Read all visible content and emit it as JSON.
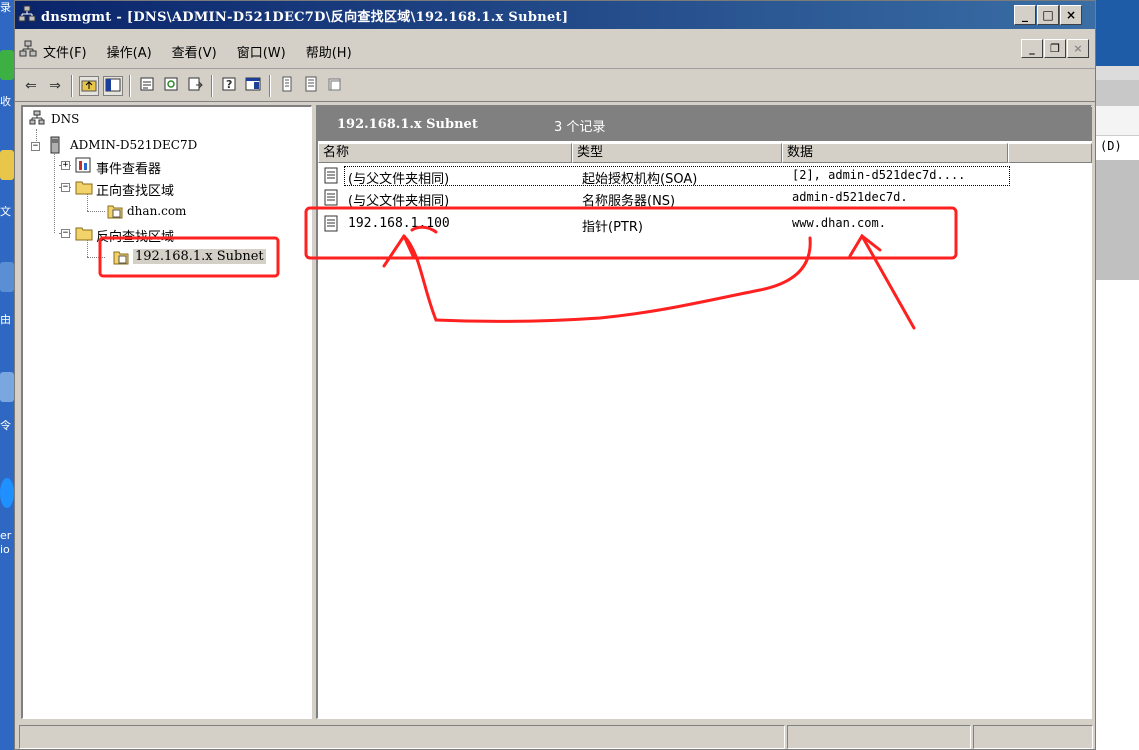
{
  "desktop": {
    "fragments": [
      "录",
      "收",
      "文",
      "由",
      "令",
      "er",
      "io"
    ]
  },
  "background_window": {
    "text": "(D)"
  },
  "window": {
    "title": "dnsmgmt - [DNS\\ADMIN-D521DEC7D\\反向查找区域\\192.168.1.x Subnet]",
    "controls": {
      "minimize": "_",
      "maximize": "□",
      "close": "×"
    },
    "mdi_controls": {
      "minimize": "_",
      "restore": "❐",
      "close": "×"
    }
  },
  "menu": {
    "items": [
      {
        "label": "文件(F)"
      },
      {
        "label": "操作(A)"
      },
      {
        "label": "查看(V)"
      },
      {
        "label": "窗口(W)"
      },
      {
        "label": "帮助(H)"
      }
    ]
  },
  "toolbar": {
    "icons": [
      "back-icon",
      "forward-icon",
      "up-folder-icon",
      "show-tree-icon",
      "properties-icon",
      "refresh-icon",
      "export-list-icon",
      "help-icon",
      "new-window-icon",
      "new-record-icon",
      "new-host-icon",
      "new-folder-icon"
    ]
  },
  "tree": {
    "root": "DNS",
    "server": "ADMIN-D521DEC7D",
    "event_viewer": "事件查看器",
    "forward_zones": "正向查找区域",
    "forward_zone_child": "dhan.com",
    "reverse_zones": "反向查找区域",
    "reverse_zone_child": "192.168.1.x Subnet"
  },
  "list": {
    "header_title": "192.168.1.x Subnet",
    "record_count": "3 个记录",
    "columns": [
      "名称",
      "类型",
      "数据"
    ],
    "rows": [
      {
        "name": "(与父文件夹相同)",
        "type": "起始授权机构(SOA)",
        "data": "[2], admin-d521dec7d...."
      },
      {
        "name": "(与父文件夹相同)",
        "type": "名称服务器(NS)",
        "data": "admin-d521dec7d."
      },
      {
        "name": "192.168.1.100",
        "type": "指针(PTR)",
        "data": "www.dhan.com."
      }
    ]
  },
  "colors": {
    "title_start": "#0a246a",
    "title_end": "#3a6ea5",
    "annotation": "#ff2020",
    "chrome": "#d4d0c8"
  }
}
